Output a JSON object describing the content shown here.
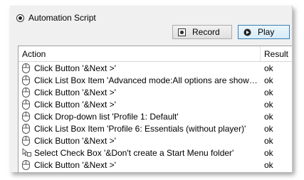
{
  "mode": {
    "label": "Automation Script",
    "selected": true
  },
  "buttons": {
    "record_label": "Record",
    "play_label": "Play"
  },
  "table": {
    "columns": [
      "Action",
      "Result"
    ],
    "rows": [
      {
        "icon": "mouse-icon",
        "action": "Click Button '&Next >'",
        "result": "ok"
      },
      {
        "icon": "mouse-icon",
        "action": "Click List Box Item 'Advanced mode:All options are shown. A cus...",
        "result": "ok"
      },
      {
        "icon": "mouse-icon",
        "action": "Click Button '&Next >'",
        "result": "ok"
      },
      {
        "icon": "mouse-icon",
        "action": "Click Button '&Next >'",
        "result": "ok"
      },
      {
        "icon": "mouse-icon",
        "action": "Click Drop-down list 'Profile 1: Default'",
        "result": "ok"
      },
      {
        "icon": "mouse-icon",
        "action": "Click List Box Item 'Profile 6: Essentials (without player)'",
        "result": "ok"
      },
      {
        "icon": "mouse-icon",
        "action": "Click Button '&Next >'",
        "result": "ok"
      },
      {
        "icon": "checkbox-cursor-icon",
        "action": "Select Check Box '&Don't create a Start Menu folder'",
        "result": "ok"
      },
      {
        "icon": "mouse-icon",
        "action": "Click Button '&Next >'",
        "result": "ok"
      }
    ]
  }
}
